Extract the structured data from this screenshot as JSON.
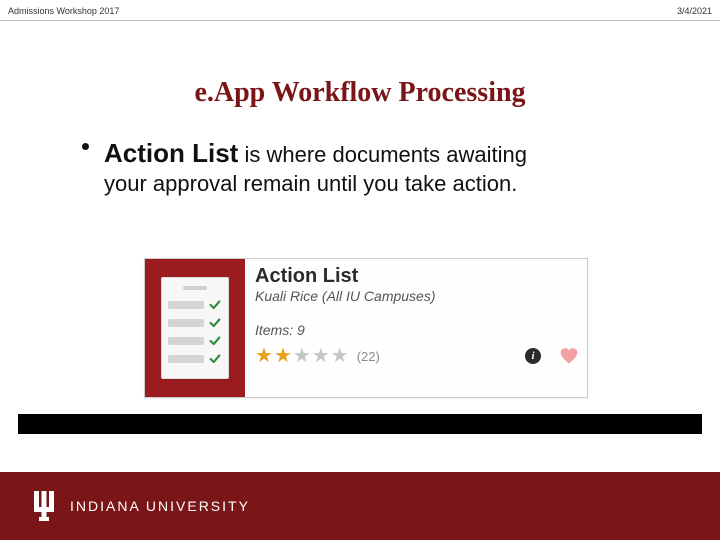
{
  "header": {
    "left": "Admissions Workshop 2017",
    "right": "3/4/2021"
  },
  "title": "e.App Workflow Processing",
  "bullet": {
    "bold": "Action List",
    "rest_line1": " is where documents awaiting",
    "line2": "your approval remain until you take action."
  },
  "card": {
    "title": "Action List",
    "subtitle_app": "Kuali Rice",
    "subtitle_scope": " (All IU Campuses)",
    "items_label": "Items: ",
    "items_count": "9",
    "reviews_count": "(22)",
    "rating_filled": 2,
    "rating_total": 5,
    "info_glyph": "i"
  },
  "footer": {
    "university": "INDIANA UNIVERSITY"
  }
}
